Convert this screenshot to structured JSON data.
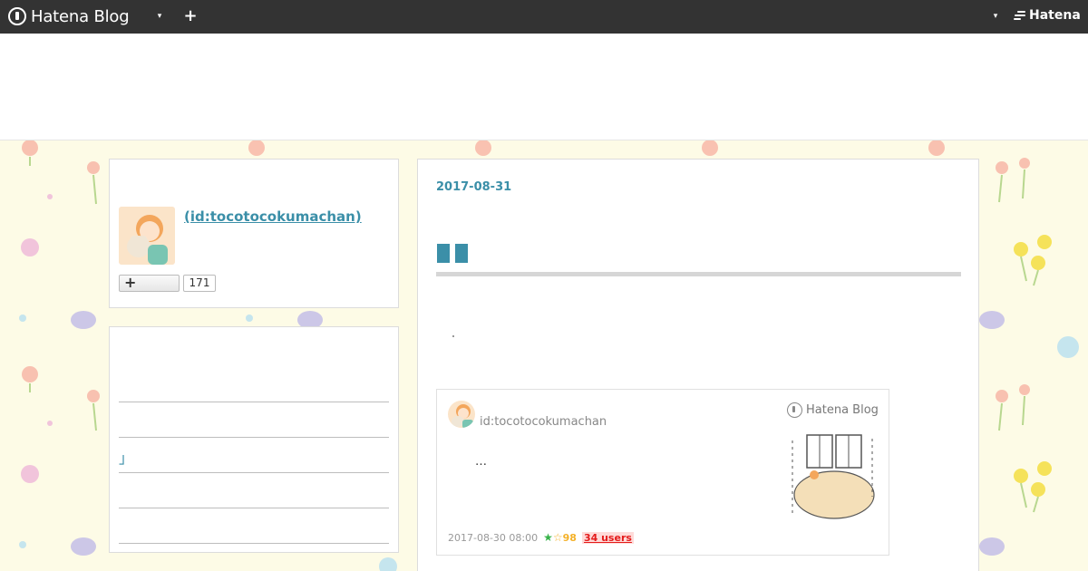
{
  "header": {
    "logo_text": "Hatena Blog",
    "menu_caret": "▾",
    "add_label": "+",
    "right_caret": "▾",
    "hatena_text": "Hatena"
  },
  "profile": {
    "name": " (id:tocotocokumachan)",
    "follow_label": "+",
    "follower_count": "171"
  },
  "sidebar_list": {
    "items": [
      "",
      "",
      "」",
      "",
      ""
    ]
  },
  "entry": {
    "date": "2017-08-31",
    "dot": "·"
  },
  "embed": {
    "user_id": "id:tocotocokumachan",
    "brand": "Hatena Blog",
    "excerpt": "…",
    "timestamp": "2017-08-30 08:00",
    "star_count": "98",
    "users_label": "34 users"
  },
  "colors": {
    "header_bg": "#333333",
    "accent": "#3b8fa8",
    "background": "#fdfbe6",
    "users_badge_bg": "#fedbd9",
    "users_badge_text": "#e41b1b",
    "star_green": "#38b34a",
    "star_yellow": "#f4b128"
  }
}
